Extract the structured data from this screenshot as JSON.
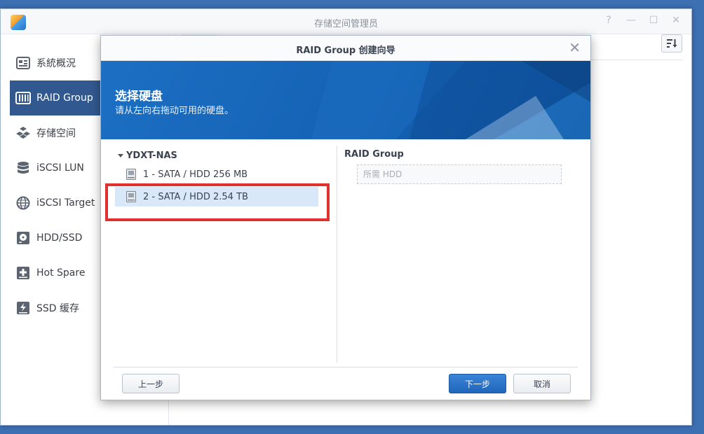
{
  "app": {
    "title": "存储空间管理员"
  },
  "window_controls": [
    "?",
    "—",
    "☐",
    "✕"
  ],
  "sidebar": {
    "items": [
      {
        "label": "系統概況",
        "icon": "overview-icon",
        "active": false
      },
      {
        "label": "RAID Group",
        "icon": "raid-icon",
        "active": true
      },
      {
        "label": "存储空间",
        "icon": "storage-cubes-icon",
        "active": false
      },
      {
        "label": "iSCSI LUN",
        "icon": "database-icon",
        "active": false
      },
      {
        "label": "iSCSI Target",
        "icon": "globe-icon",
        "active": false
      },
      {
        "label": "HDD/SSD",
        "icon": "hdd-icon",
        "active": false
      },
      {
        "label": "Hot Spare",
        "icon": "hot-spare-plus-icon",
        "active": false
      },
      {
        "label": "SSD 缓存",
        "icon": "ssd-cache-icon",
        "active": false
      }
    ]
  },
  "modal": {
    "title": "RAID Group 创建向导",
    "banner": {
      "title": "选择硬盘",
      "subtitle": "请从左向右拖动可用的硬盘。"
    },
    "disk_group": {
      "name": "YDXT-NAS",
      "disks": [
        {
          "label": "1 - SATA / HDD 256 MB",
          "selected": false
        },
        {
          "label": "2 - SATA / HDD 2.54 TB",
          "selected": true
        }
      ]
    },
    "raid_group": {
      "title": "RAID Group",
      "drop_placeholder": "所需 HDD"
    },
    "buttons": {
      "back": "上一步",
      "next": "下一步",
      "cancel": "取消"
    }
  },
  "colors": {
    "desktop": "#3d6fb3",
    "sidebar_active": "#32598f",
    "banner": "#1462b4",
    "highlight": "#e0302f",
    "primary_button": "#2a72c4"
  }
}
